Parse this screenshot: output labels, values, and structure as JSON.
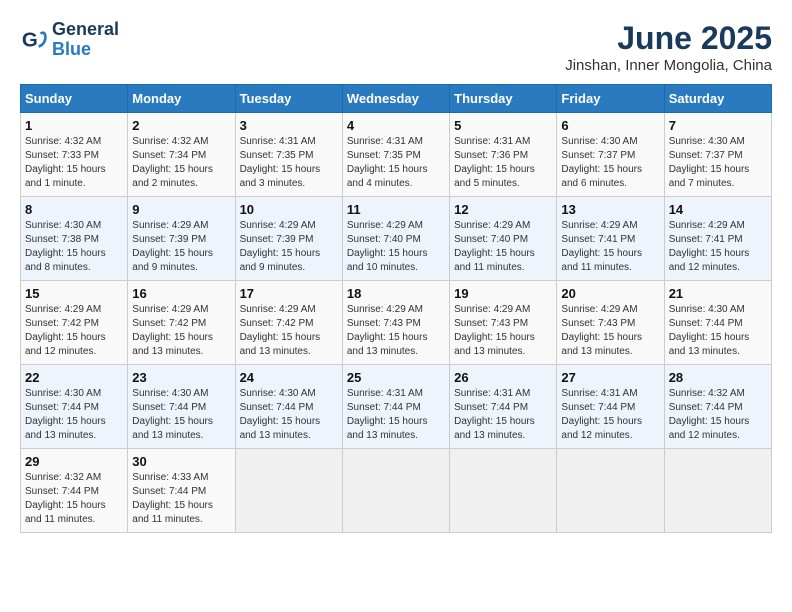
{
  "logo": {
    "line1": "General",
    "line2": "Blue"
  },
  "title": "June 2025",
  "subtitle": "Jinshan, Inner Mongolia, China",
  "days_of_week": [
    "Sunday",
    "Monday",
    "Tuesday",
    "Wednesday",
    "Thursday",
    "Friday",
    "Saturday"
  ],
  "weeks": [
    [
      {
        "day": "1",
        "sunrise": "4:32 AM",
        "sunset": "7:33 PM",
        "daylight": "15 hours and 1 minute."
      },
      {
        "day": "2",
        "sunrise": "4:32 AM",
        "sunset": "7:34 PM",
        "daylight": "15 hours and 2 minutes."
      },
      {
        "day": "3",
        "sunrise": "4:31 AM",
        "sunset": "7:35 PM",
        "daylight": "15 hours and 3 minutes."
      },
      {
        "day": "4",
        "sunrise": "4:31 AM",
        "sunset": "7:35 PM",
        "daylight": "15 hours and 4 minutes."
      },
      {
        "day": "5",
        "sunrise": "4:31 AM",
        "sunset": "7:36 PM",
        "daylight": "15 hours and 5 minutes."
      },
      {
        "day": "6",
        "sunrise": "4:30 AM",
        "sunset": "7:37 PM",
        "daylight": "15 hours and 6 minutes."
      },
      {
        "day": "7",
        "sunrise": "4:30 AM",
        "sunset": "7:37 PM",
        "daylight": "15 hours and 7 minutes."
      }
    ],
    [
      {
        "day": "8",
        "sunrise": "4:30 AM",
        "sunset": "7:38 PM",
        "daylight": "15 hours and 8 minutes."
      },
      {
        "day": "9",
        "sunrise": "4:29 AM",
        "sunset": "7:39 PM",
        "daylight": "15 hours and 9 minutes."
      },
      {
        "day": "10",
        "sunrise": "4:29 AM",
        "sunset": "7:39 PM",
        "daylight": "15 hours and 9 minutes."
      },
      {
        "day": "11",
        "sunrise": "4:29 AM",
        "sunset": "7:40 PM",
        "daylight": "15 hours and 10 minutes."
      },
      {
        "day": "12",
        "sunrise": "4:29 AM",
        "sunset": "7:40 PM",
        "daylight": "15 hours and 11 minutes."
      },
      {
        "day": "13",
        "sunrise": "4:29 AM",
        "sunset": "7:41 PM",
        "daylight": "15 hours and 11 minutes."
      },
      {
        "day": "14",
        "sunrise": "4:29 AM",
        "sunset": "7:41 PM",
        "daylight": "15 hours and 12 minutes."
      }
    ],
    [
      {
        "day": "15",
        "sunrise": "4:29 AM",
        "sunset": "7:42 PM",
        "daylight": "15 hours and 12 minutes."
      },
      {
        "day": "16",
        "sunrise": "4:29 AM",
        "sunset": "7:42 PM",
        "daylight": "15 hours and 13 minutes."
      },
      {
        "day": "17",
        "sunrise": "4:29 AM",
        "sunset": "7:42 PM",
        "daylight": "15 hours and 13 minutes."
      },
      {
        "day": "18",
        "sunrise": "4:29 AM",
        "sunset": "7:43 PM",
        "daylight": "15 hours and 13 minutes."
      },
      {
        "day": "19",
        "sunrise": "4:29 AM",
        "sunset": "7:43 PM",
        "daylight": "15 hours and 13 minutes."
      },
      {
        "day": "20",
        "sunrise": "4:29 AM",
        "sunset": "7:43 PM",
        "daylight": "15 hours and 13 minutes."
      },
      {
        "day": "21",
        "sunrise": "4:30 AM",
        "sunset": "7:44 PM",
        "daylight": "15 hours and 13 minutes."
      }
    ],
    [
      {
        "day": "22",
        "sunrise": "4:30 AM",
        "sunset": "7:44 PM",
        "daylight": "15 hours and 13 minutes."
      },
      {
        "day": "23",
        "sunrise": "4:30 AM",
        "sunset": "7:44 PM",
        "daylight": "15 hours and 13 minutes."
      },
      {
        "day": "24",
        "sunrise": "4:30 AM",
        "sunset": "7:44 PM",
        "daylight": "15 hours and 13 minutes."
      },
      {
        "day": "25",
        "sunrise": "4:31 AM",
        "sunset": "7:44 PM",
        "daylight": "15 hours and 13 minutes."
      },
      {
        "day": "26",
        "sunrise": "4:31 AM",
        "sunset": "7:44 PM",
        "daylight": "15 hours and 13 minutes."
      },
      {
        "day": "27",
        "sunrise": "4:31 AM",
        "sunset": "7:44 PM",
        "daylight": "15 hours and 12 minutes."
      },
      {
        "day": "28",
        "sunrise": "4:32 AM",
        "sunset": "7:44 PM",
        "daylight": "15 hours and 12 minutes."
      }
    ],
    [
      {
        "day": "29",
        "sunrise": "4:32 AM",
        "sunset": "7:44 PM",
        "daylight": "15 hours and 11 minutes."
      },
      {
        "day": "30",
        "sunrise": "4:33 AM",
        "sunset": "7:44 PM",
        "daylight": "15 hours and 11 minutes."
      },
      null,
      null,
      null,
      null,
      null
    ]
  ],
  "labels": {
    "sunrise": "Sunrise:",
    "sunset": "Sunset:",
    "daylight": "Daylight:"
  }
}
